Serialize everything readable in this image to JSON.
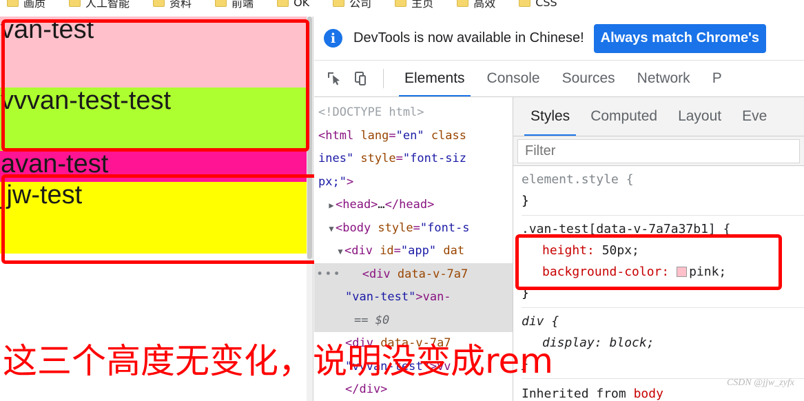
{
  "bookmarks_bar": {
    "items": [
      {
        "label": "画质",
        "icon": "folder-icon"
      },
      {
        "label": "人工智能",
        "icon": "folder-icon"
      },
      {
        "label": "资料",
        "icon": "folder-icon"
      },
      {
        "label": "前端",
        "icon": "folder-icon"
      },
      {
        "label": "OK",
        "icon": "folder-icon"
      },
      {
        "label": "公司",
        "icon": "folder-icon"
      },
      {
        "label": "主页",
        "icon": "folder-icon"
      },
      {
        "label": "高效",
        "icon": "folder-icon"
      },
      {
        "label": "CSS",
        "icon": "folder-icon"
      }
    ]
  },
  "page": {
    "blocks": [
      {
        "text": "van-test",
        "bg": "#ffc0cb",
        "name": "van-test"
      },
      {
        "text": "vvvan-test-test",
        "bg": "#adff2f",
        "name": "vvvan-test-test"
      },
      {
        "text": "avan-test",
        "bg": "#ff1493",
        "name": "avan-test"
      },
      {
        "text": "jjw-test",
        "bg": "#ffff00",
        "name": "jjw-test"
      }
    ],
    "annotation": "这三个高度无变化，说明没变成rem",
    "annotation_color": "#ff0000"
  },
  "devtools": {
    "banner": {
      "icon": "info-icon",
      "message": "DevTools is now available in Chinese!",
      "button_label": "Always match Chrome's",
      "button_color": "#1a73e8"
    },
    "toolbar": {
      "inspect_icon": "inspect-element-icon",
      "device_icon": "device-toolbar-icon"
    },
    "tabs": [
      {
        "label": "Elements",
        "active": true
      },
      {
        "label": "Console",
        "active": false
      },
      {
        "label": "Sources",
        "active": false
      },
      {
        "label": "Network",
        "active": false
      },
      {
        "label": "P",
        "active": false
      }
    ],
    "dom_tree": {
      "lines": [
        {
          "parts": [
            {
              "t": "<!DOCTYPE html>",
              "c": "tok-comment"
            }
          ],
          "indent": 0,
          "marker": "",
          "selected": false
        },
        {
          "parts": [
            {
              "t": "<html ",
              "c": "tok-tag"
            },
            {
              "t": "lang",
              "c": "tok-attr"
            },
            {
              "t": "=",
              "c": "tok-tag"
            },
            {
              "t": "\"en\"",
              "c": "tok-val"
            },
            {
              "t": " class",
              "c": "tok-attr"
            }
          ],
          "indent": 0,
          "marker": "",
          "selected": false
        },
        {
          "parts": [
            {
              "t": "ines\"",
              "c": "tok-val"
            },
            {
              "t": " style",
              "c": "tok-attr"
            },
            {
              "t": "=",
              "c": "tok-tag"
            },
            {
              "t": "\"font-siz",
              "c": "tok-val"
            }
          ],
          "indent": 0,
          "marker": "",
          "selected": false
        },
        {
          "parts": [
            {
              "t": "px;\"",
              "c": "tok-val"
            },
            {
              "t": ">",
              "c": "tok-tag"
            }
          ],
          "indent": 0,
          "marker": "",
          "selected": false
        },
        {
          "parts": [
            {
              "t": "<head>",
              "c": "tok-tag"
            },
            {
              "t": "…",
              "c": "tok-text"
            },
            {
              "t": "</head>",
              "c": "tok-tag"
            }
          ],
          "indent": 1,
          "marker": "right",
          "selected": false
        },
        {
          "parts": [
            {
              "t": "<body ",
              "c": "tok-tag"
            },
            {
              "t": "style",
              "c": "tok-attr"
            },
            {
              "t": "=",
              "c": "tok-tag"
            },
            {
              "t": "\"font-s",
              "c": "tok-val"
            }
          ],
          "indent": 1,
          "marker": "down",
          "selected": false
        },
        {
          "parts": [
            {
              "t": "<div ",
              "c": "tok-tag"
            },
            {
              "t": "id",
              "c": "tok-attr"
            },
            {
              "t": "=",
              "c": "tok-tag"
            },
            {
              "t": "\"app\"",
              "c": "tok-val"
            },
            {
              "t": " dat",
              "c": "tok-attr"
            }
          ],
          "indent": 2,
          "marker": "down",
          "selected": false
        },
        {
          "parts": [
            {
              "t": "<div ",
              "c": "tok-tag"
            },
            {
              "t": "data-v-7a7",
              "c": "tok-attr"
            }
          ],
          "indent": 3,
          "marker": "dots",
          "selected": true
        },
        {
          "parts": [
            {
              "t": "\"van-test\"",
              "c": "tok-val"
            },
            {
              "t": ">van-",
              "c": "tok-tag"
            }
          ],
          "indent": 3,
          "marker": "",
          "selected": true
        },
        {
          "parts": [
            {
              "t": "== $0",
              "c": "tok-dollar"
            }
          ],
          "indent": 4,
          "marker": "",
          "selected": true
        },
        {
          "parts": [
            {
              "t": "<div ",
              "c": "tok-tag"
            },
            {
              "t": "data-v-7a7",
              "c": "tok-attr"
            }
          ],
          "indent": 3,
          "marker": "",
          "selected": false
        },
        {
          "parts": [
            {
              "t": "\"vvvan-test\"",
              "c": "tok-val"
            },
            {
              "t": ">vv",
              "c": "tok-tag"
            }
          ],
          "indent": 3,
          "marker": "",
          "selected": false
        },
        {
          "parts": [
            {
              "t": "</div>",
              "c": "tok-tag"
            }
          ],
          "indent": 3,
          "marker": "",
          "selected": false
        }
      ]
    },
    "styles": {
      "tabs": [
        {
          "label": "Styles",
          "active": true
        },
        {
          "label": "Computed",
          "active": false
        },
        {
          "label": "Layout",
          "active": false
        },
        {
          "label": "Eve",
          "active": false
        }
      ],
      "filter_placeholder": "Filter",
      "filter_value": "",
      "rules": [
        {
          "selector": "element.style {",
          "selector_style": "gray",
          "declarations": [],
          "close": "}"
        },
        {
          "selector": ".van-test[data-v-7a7a37b1] {",
          "selector_style": "normal",
          "declarations": [
            {
              "prop": "height",
              "value": "50px;",
              "swatch": null
            },
            {
              "prop": "background-color",
              "value": "pink;",
              "swatch": "#ffc0cb"
            }
          ],
          "close": "}"
        },
        {
          "selector": "div {",
          "selector_style": "ua",
          "declarations": [
            {
              "prop": "display",
              "value": "block;",
              "swatch": null
            }
          ],
          "close": "}"
        }
      ],
      "inherited_from_label": "Inherited from",
      "inherited_from_target": "body"
    }
  },
  "watermark": "CSDN @jjw_zyfx"
}
